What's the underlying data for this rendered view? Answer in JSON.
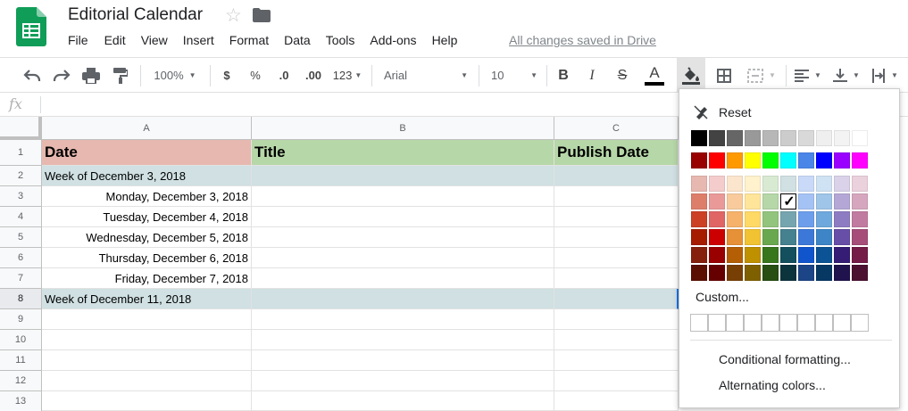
{
  "app": {
    "title": "Editorial Calendar",
    "save_status": "All changes saved in Drive",
    "menu": [
      "File",
      "Edit",
      "View",
      "Insert",
      "Format",
      "Data",
      "Tools",
      "Add-ons",
      "Help"
    ]
  },
  "toolbar": {
    "zoom": "100%",
    "currency": "$",
    "percent": "%",
    "decrease_decimals": ".0",
    "increase_decimals": ".00",
    "more_formats": "123",
    "font": "Arial",
    "font_size": "10",
    "bold": "B",
    "italic": "I",
    "strike": "S",
    "text_color": "A"
  },
  "formula_bar": {
    "fx": "fx"
  },
  "sheet": {
    "columns": [
      "A",
      "B",
      "C"
    ],
    "rows": [
      "1",
      "2",
      "3",
      "4",
      "5",
      "6",
      "7",
      "8",
      "9",
      "10",
      "11",
      "12",
      "13"
    ],
    "cells": {
      "A1": "Date",
      "B1": "Title",
      "C1": "Publish Date",
      "A2": "Week of December 3, 2018",
      "A3": "Monday, December 3, 2018",
      "A4": "Tuesday, December 4, 2018",
      "A5": "Wednesday, December 5, 2018",
      "A6": "Thursday, December 6, 2018",
      "A7": "Friday, December 7, 2018",
      "A8": "Week of December 11, 2018"
    },
    "colors": {
      "header_a": "#e6b8af",
      "header_b": "#b6d7a8",
      "header_c": "#b6d7a8",
      "week_row": "#d0e0e3"
    }
  },
  "fill_menu": {
    "reset": "Reset",
    "custom": "Custom...",
    "conditional_formatting": "Conditional formatting...",
    "alternating_colors": "Alternating colors...",
    "selected_color": "#a2c4c9",
    "gray_row": [
      "#000000",
      "#434343",
      "#666666",
      "#999999",
      "#b7b7b7",
      "#cccccc",
      "#d9d9d9",
      "#efefef",
      "#f3f3f3",
      "#ffffff"
    ],
    "bright_row": [
      "#980000",
      "#ff0000",
      "#ff9900",
      "#ffff00",
      "#00ff00",
      "#00ffff",
      "#4a86e8",
      "#0000ff",
      "#9900ff",
      "#ff00ff"
    ],
    "shade_rows": [
      [
        "#e6b8af",
        "#f4cccc",
        "#fce5cd",
        "#fff2cc",
        "#d9ead3",
        "#d0e0e3",
        "#c9daf8",
        "#cfe2f3",
        "#d9d2e9",
        "#ead1dc"
      ],
      [
        "#dd7e6b",
        "#ea9999",
        "#f9cb9c",
        "#ffe599",
        "#b6d7a8",
        "#a2c4c9",
        "#a4c2f4",
        "#9fc5e8",
        "#b4a7d6",
        "#d5a6bd"
      ],
      [
        "#cc4125",
        "#e06666",
        "#f6b26b",
        "#ffd966",
        "#93c47d",
        "#76a5af",
        "#6d9eeb",
        "#6fa8dc",
        "#8e7cc3",
        "#c27ba0"
      ],
      [
        "#a61c00",
        "#cc0000",
        "#e69138",
        "#f1c232",
        "#6aa84f",
        "#45818e",
        "#3c78d8",
        "#3d85c6",
        "#674ea7",
        "#a64d79"
      ],
      [
        "#85200c",
        "#990000",
        "#b45f06",
        "#bf9000",
        "#38761d",
        "#134f5c",
        "#1155cc",
        "#0b5394",
        "#351c75",
        "#741b47"
      ],
      [
        "#5b0f00",
        "#660000",
        "#783f04",
        "#7f6000",
        "#274e13",
        "#0c343d",
        "#1c4587",
        "#073763",
        "#20124d",
        "#4c1130"
      ]
    ]
  }
}
